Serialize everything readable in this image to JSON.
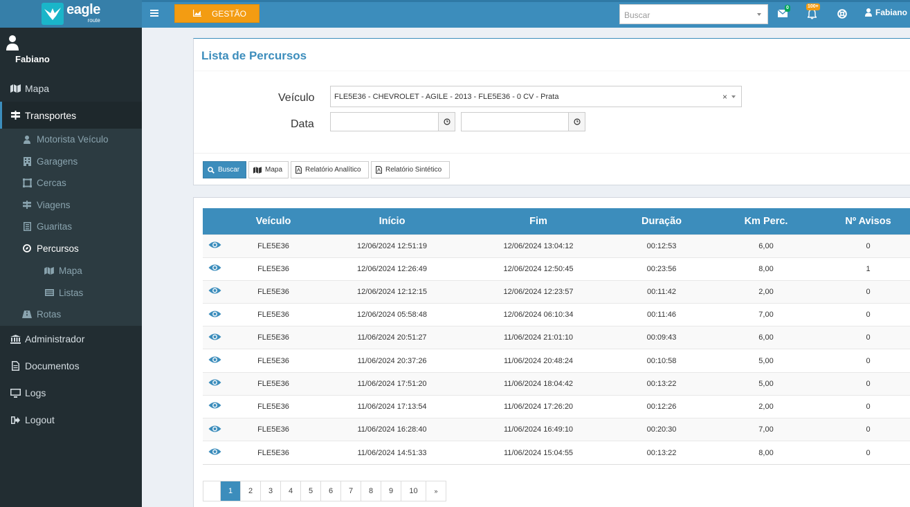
{
  "app": {
    "logo_text": "eagle",
    "logo_sub": "route",
    "accent_color": "#3c8dbc",
    "sidebar_color": "#222d32",
    "gestao_color": "#f39c12"
  },
  "sidebar": {
    "user_name": "Fabiano",
    "items": [
      {
        "label": "Mapa",
        "icon": "map-icon"
      },
      {
        "label": "Transportes",
        "icon": "signpost-icon"
      },
      {
        "label": "Administrador",
        "icon": "bank-icon"
      },
      {
        "label": "Documentos",
        "icon": "document-icon"
      },
      {
        "label": "Logs",
        "icon": "monitor-icon"
      },
      {
        "label": "Logout",
        "icon": "sign-out-icon"
      }
    ],
    "transportes_sub": [
      {
        "label": "Motorista Veículo",
        "icon": "user-icon"
      },
      {
        "label": "Garagens",
        "icon": "building-icon"
      },
      {
        "label": "Cercas",
        "icon": "fence-icon"
      },
      {
        "label": "Viagens",
        "icon": "signpost-icon"
      },
      {
        "label": "Guaritas",
        "icon": "guard-icon"
      },
      {
        "label": "Percursos",
        "icon": "compass-icon"
      },
      {
        "label": "Rotas",
        "icon": "road-icon"
      }
    ],
    "percursos_sub": [
      {
        "label": "Mapa",
        "icon": "map-icon"
      },
      {
        "label": "Listas",
        "icon": "list-icon"
      }
    ]
  },
  "topbar": {
    "gestao_label": "GESTÃO",
    "search_placeholder": "Buscar",
    "mail_badge": "0",
    "bell_badge": "100+",
    "user_label": "Fabiano I"
  },
  "filter": {
    "title": "Lista de Percursos",
    "veiculo_label": "Veículo",
    "veiculo_value": "FLE5E36 - CHEVROLET - AGILE - 2013 - FLE5E36 - 0 CV - Prata",
    "clear_symbol": "×",
    "data_label": "Data",
    "date_start": "",
    "date_end": "",
    "buttons": {
      "buscar": "Buscar",
      "mapa": "Mapa",
      "relatorio_analitico": "Relatório Analítico",
      "relatorio_sintetico": "Relatório Sintético"
    }
  },
  "table": {
    "columns": [
      "",
      "Veículo",
      "Início",
      "Fim",
      "Duração",
      "Km Perc.",
      "Nº Avisos"
    ],
    "rows": [
      [
        "FLE5E36",
        "12/06/2024 12:51:19",
        "12/06/2024 13:04:12",
        "00:12:53",
        "6,00",
        "0"
      ],
      [
        "FLE5E36",
        "12/06/2024 12:26:49",
        "12/06/2024 12:50:45",
        "00:23:56",
        "8,00",
        "1"
      ],
      [
        "FLE5E36",
        "12/06/2024 12:12:15",
        "12/06/2024 12:23:57",
        "00:11:42",
        "2,00",
        "0"
      ],
      [
        "FLE5E36",
        "12/06/2024 05:58:48",
        "12/06/2024 06:10:34",
        "00:11:46",
        "7,00",
        "0"
      ],
      [
        "FLE5E36",
        "11/06/2024 20:51:27",
        "11/06/2024 21:01:10",
        "00:09:43",
        "6,00",
        "0"
      ],
      [
        "FLE5E36",
        "11/06/2024 20:37:26",
        "11/06/2024 20:48:24",
        "00:10:58",
        "5,00",
        "0"
      ],
      [
        "FLE5E36",
        "11/06/2024 17:51:20",
        "11/06/2024 18:04:42",
        "00:13:22",
        "5,00",
        "0"
      ],
      [
        "FLE5E36",
        "11/06/2024 17:13:54",
        "11/06/2024 17:26:20",
        "00:12:26",
        "2,00",
        "0"
      ],
      [
        "FLE5E36",
        "11/06/2024 16:28:40",
        "11/06/2024 16:49:10",
        "00:20:30",
        "7,00",
        "0"
      ],
      [
        "FLE5E36",
        "11/06/2024 14:51:33",
        "11/06/2024 15:04:55",
        "00:13:22",
        "8,00",
        "0"
      ]
    ]
  },
  "pagination": {
    "pages": [
      "1",
      "2",
      "3",
      "4",
      "5",
      "6",
      "7",
      "8",
      "9",
      "10"
    ],
    "active": "1",
    "next": "»"
  }
}
